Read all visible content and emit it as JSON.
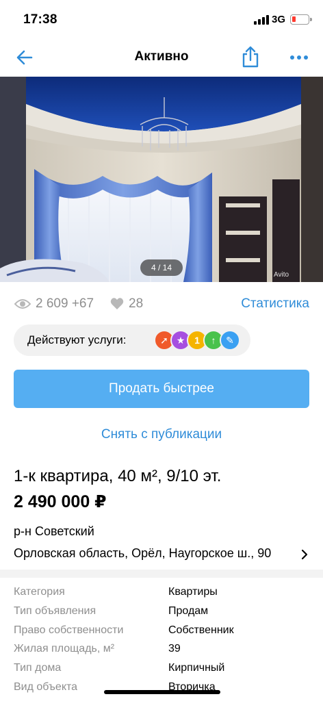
{
  "status_bar": {
    "time": "17:38",
    "network": "3G",
    "battery_level": 0.15,
    "battery_color": "#ff3b30"
  },
  "nav": {
    "title": "Активно",
    "back_icon": "arrow-left-icon",
    "share_icon": "share-icon",
    "more_icon": "more-dots-icon",
    "accent_color": "#2f8cd8"
  },
  "gallery": {
    "counter": "4 / 14",
    "watermark": "Avito"
  },
  "stats": {
    "views": "2 609 +67",
    "likes": "28",
    "statistics_link": "Статистика"
  },
  "services": {
    "label": "Действуют услуги:",
    "icons": [
      {
        "name": "rocket-icon",
        "color": "#f05a2b"
      },
      {
        "name": "star-icon",
        "color": "#a64fe0"
      },
      {
        "name": "number-one-icon",
        "color": "#f5b400"
      },
      {
        "name": "arrow-up-icon",
        "color": "#49c24c"
      },
      {
        "name": "tag-icon",
        "color": "#3aa0f2"
      }
    ]
  },
  "actions": {
    "sell_faster": "Продать быстрее",
    "unpublish": "Снять с публикации",
    "primary_color": "#55aef2"
  },
  "listing": {
    "title": "1-к квартира, 40 м², 9/10 эт.",
    "price": "2 490 000 ₽",
    "district": "р-н Советский",
    "address": "Орловская область, Орёл, Наугорское ш., 90"
  },
  "params": [
    {
      "label": "Категория",
      "value": "Квартиры"
    },
    {
      "label": "Тип объявления",
      "value": "Продам"
    },
    {
      "label": "Право собственности",
      "value": "Собственник"
    },
    {
      "label": "Жилая площадь, м²",
      "value": "39"
    },
    {
      "label": "Тип дома",
      "value": "Кирпичный"
    },
    {
      "label": "Вид объекта",
      "value": "Вторичка"
    }
  ]
}
